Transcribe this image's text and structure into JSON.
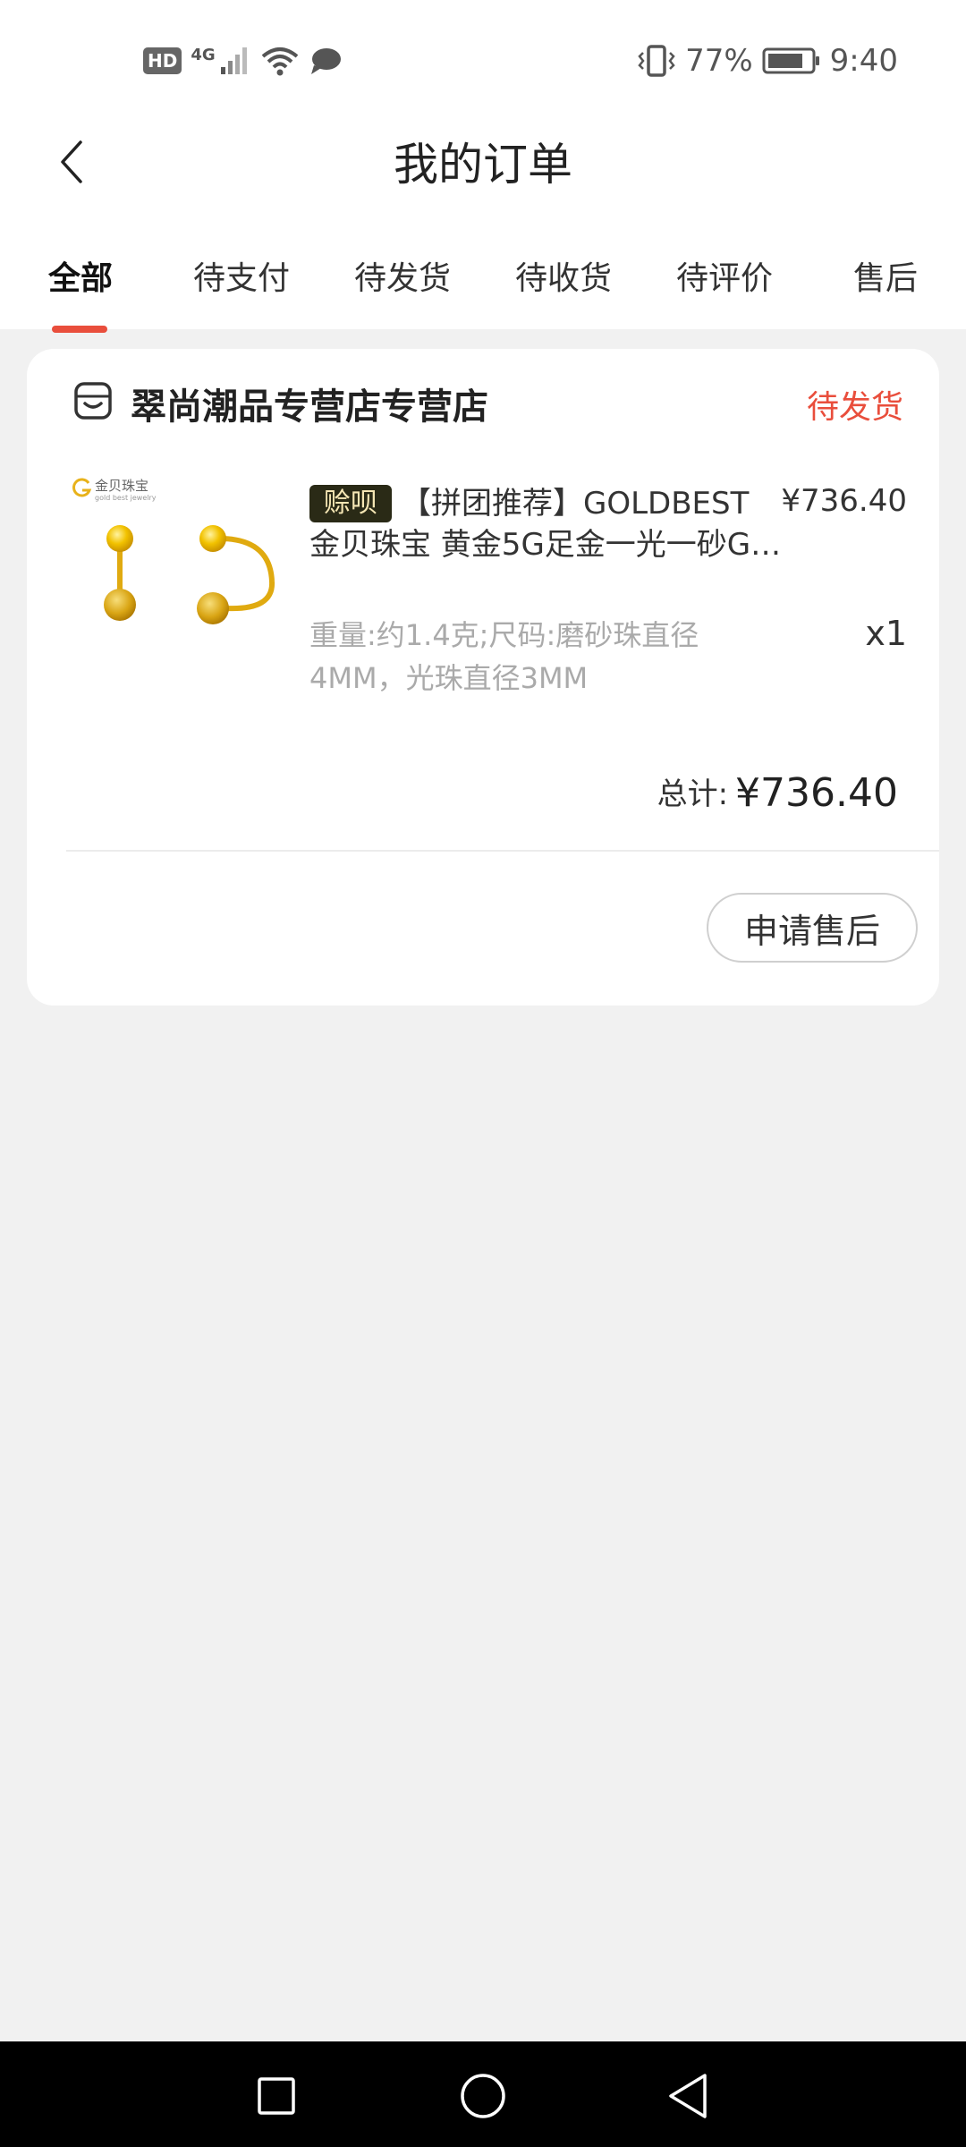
{
  "status_bar": {
    "hd_label": "HD",
    "network_label": "4G",
    "battery_percent": "77%",
    "time": "9:40"
  },
  "header": {
    "title": "我的订单"
  },
  "tabs": [
    {
      "label": "全部",
      "active": true
    },
    {
      "label": "待支付",
      "active": false
    },
    {
      "label": "待发货",
      "active": false
    },
    {
      "label": "待收货",
      "active": false
    },
    {
      "label": "待评价",
      "active": false
    },
    {
      "label": "售后",
      "active": false
    }
  ],
  "order": {
    "shop_name": "翠尚潮品专营店专营店",
    "status": "待发货",
    "product": {
      "tag": "赊呗",
      "title_line1": "【拼团推荐】GOLDBEST",
      "title_line2": "金贝珠宝 黄金5G足金一光一砂G…",
      "unit_price": "¥736.40",
      "spec": "重量:约1.4克;尺码:磨砂珠直径4MM，光珠直径3MM",
      "quantity": "x1",
      "brand_text": "金贝珠宝",
      "brand_sub": "gold best jewelry"
    },
    "total_label": "总计:",
    "total_value": "¥736.40",
    "aftersale_button": "申请售后"
  },
  "colors": {
    "accent": "#e94e3c",
    "page_bg": "#f1f1f1",
    "tag_bg": "#2a2a16",
    "tag_text": "#f5e6b4"
  }
}
